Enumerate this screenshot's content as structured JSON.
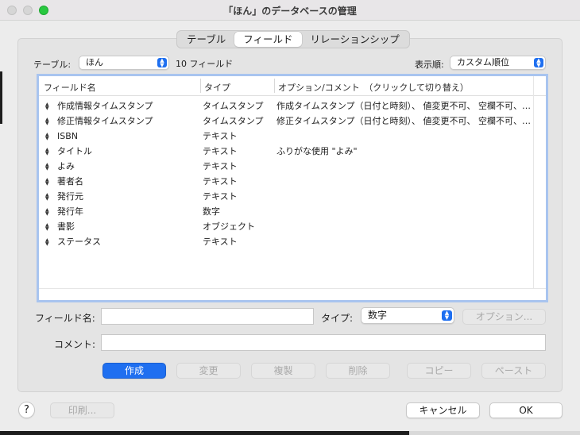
{
  "window": {
    "title": "「ほん」のデータベースの管理"
  },
  "tabs": [
    {
      "label": "テーブル",
      "active": false
    },
    {
      "label": "フィールド",
      "active": true
    },
    {
      "label": "リレーションシップ",
      "active": false
    }
  ],
  "table_select": {
    "label": "テーブル:",
    "value": "ほん",
    "count": "10 フィールド"
  },
  "sort_select": {
    "label": "表示順:",
    "value": "カスタム順位"
  },
  "list": {
    "columns": [
      "フィールド名",
      "タイプ",
      "オプション/コメント　（クリックして切り替え）"
    ],
    "rows": [
      {
        "name": "作成情報タイムスタンプ",
        "type": "タイムスタンプ",
        "options": "作成タイムスタンプ（日付と時刻）、 値変更不可、 空欄不可、 西暦…"
      },
      {
        "name": "修正情報タイムスタンプ",
        "type": "タイムスタンプ",
        "options": "修正タイムスタンプ（日付と時刻）、 値変更不可、 空欄不可、 西暦…"
      },
      {
        "name": "ISBN",
        "type": "テキスト",
        "options": ""
      },
      {
        "name": "タイトル",
        "type": "テキスト",
        "options": "ふりがな使用 \"よみ\""
      },
      {
        "name": "よみ",
        "type": "テキスト",
        "options": ""
      },
      {
        "name": "著者名",
        "type": "テキスト",
        "options": ""
      },
      {
        "name": "発行元",
        "type": "テキスト",
        "options": ""
      },
      {
        "name": "発行年",
        "type": "数字",
        "options": ""
      },
      {
        "name": "書影",
        "type": "オブジェクト",
        "options": ""
      },
      {
        "name": "ステータス",
        "type": "テキスト",
        "options": ""
      }
    ]
  },
  "form": {
    "field_name_label": "フィールド名:",
    "field_name_value": "",
    "type_label": "タイプ:",
    "type_value": "数字",
    "options_button": "オプション...",
    "comment_label": "コメント:",
    "comment_value": ""
  },
  "actions": {
    "create": "作成",
    "change": "変更",
    "duplicate": "複製",
    "delete": "削除",
    "copy": "コピー",
    "paste": "ペースト"
  },
  "footer": {
    "help": "?",
    "print": "印刷...",
    "cancel": "キャンセル",
    "ok": "OK"
  },
  "colors": {
    "accent": "#1f6ff0",
    "focus_ring": "#a8c4ef"
  }
}
